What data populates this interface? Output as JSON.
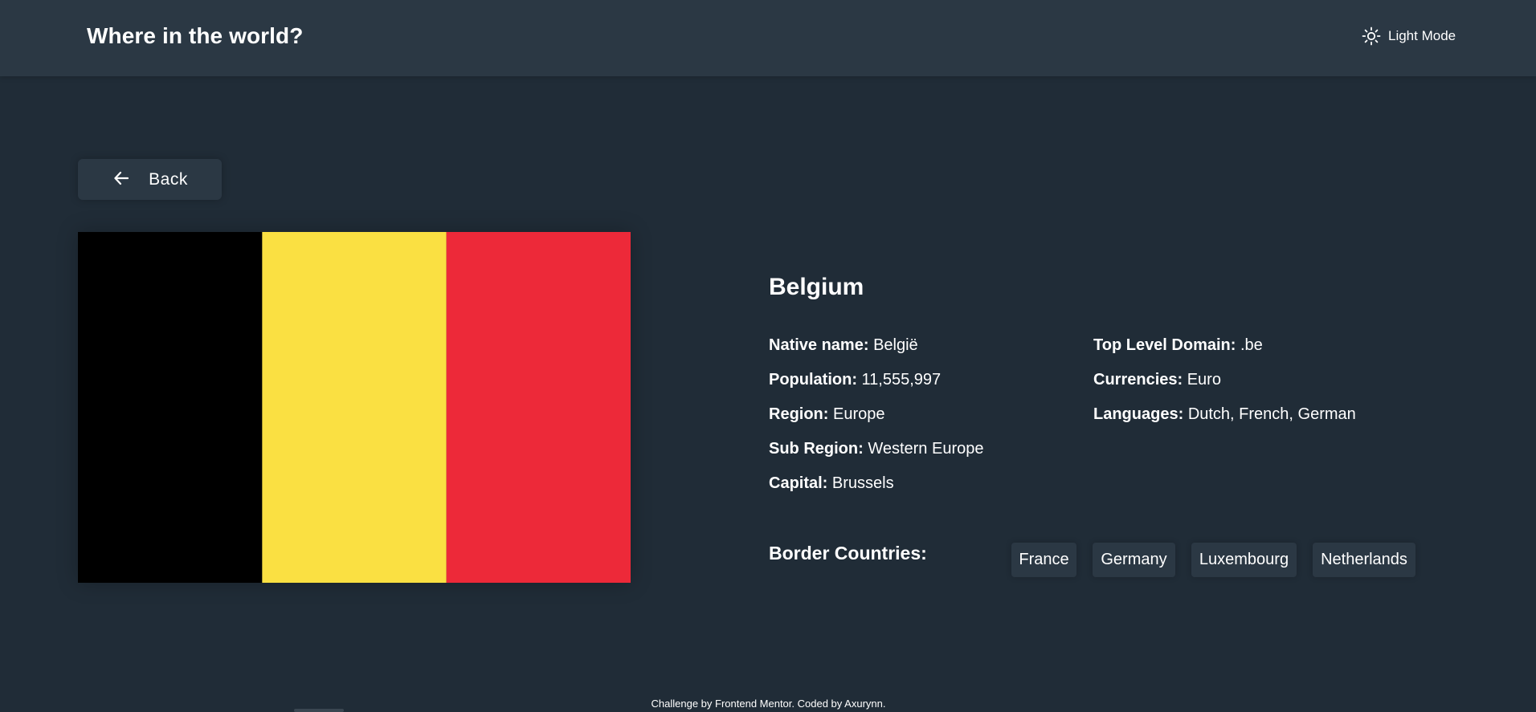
{
  "header": {
    "title": "Where in the world?",
    "theme_toggle": {
      "label": "Light Mode",
      "icon": "sun-icon"
    }
  },
  "back_button": {
    "label": "Back",
    "icon": "arrow-left-icon"
  },
  "flag": {
    "country": "Belgium",
    "stripes": [
      "#000000",
      "#fae042",
      "#ed2939"
    ]
  },
  "country": {
    "name": "Belgium",
    "details_left": [
      {
        "key": "Native name:",
        "value": "België"
      },
      {
        "key": "Population:",
        "value": "11,555,997"
      },
      {
        "key": "Region:",
        "value": "Europe"
      },
      {
        "key": "Sub Region:",
        "value": "Western Europe"
      },
      {
        "key": "Capital:",
        "value": "Brussels"
      }
    ],
    "details_right": [
      {
        "key": "Top Level Domain:",
        "value": ".be"
      },
      {
        "key": "Currencies:",
        "value": "Euro"
      },
      {
        "key": "Languages:",
        "value": "Dutch, French, German"
      }
    ],
    "border_label": "Border Countries:",
    "border_countries": [
      "France",
      "Germany",
      "Luxembourg",
      "Netherlands"
    ]
  },
  "footer": {
    "text": "Challenge by Frontend Mentor. Coded by Axurynn."
  },
  "colors": {
    "background": "#202c37",
    "surface": "#2b3844",
    "text": "#ffffff"
  }
}
